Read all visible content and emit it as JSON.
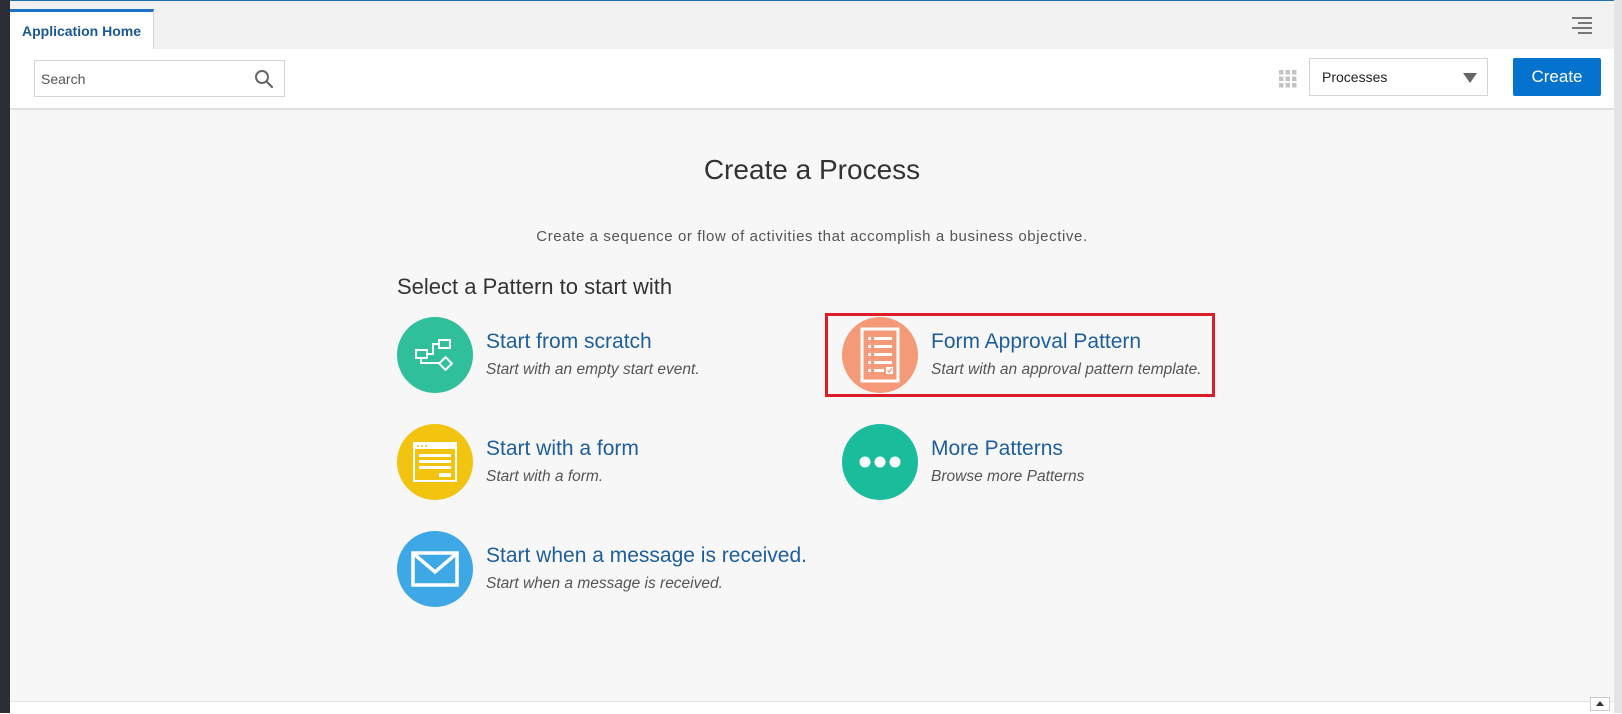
{
  "tab": {
    "label": "Application Home"
  },
  "toolbar": {
    "search_placeholder": "Search",
    "select_value": "Processes",
    "create_label": "Create"
  },
  "main": {
    "title": "Create a Process",
    "subtitle": "Create a sequence or flow of activities that accomplish a business objective.",
    "section_title": "Select a Pattern to start with",
    "patterns": [
      {
        "title": "Start from scratch",
        "description": "Start with an empty start event.",
        "icon": "flowchart-icon",
        "color": "#2fbf9b"
      },
      {
        "title": "Form Approval Pattern",
        "description": "Start with an approval pattern template.",
        "icon": "checklist-document-icon",
        "color": "#f59a78",
        "highlighted": true
      },
      {
        "title": "Start with a form",
        "description": "Start with a form.",
        "icon": "form-window-icon",
        "color": "#f2c410"
      },
      {
        "title": "More Patterns",
        "description": "Browse more Patterns",
        "icon": "ellipsis-icon",
        "color": "#19bd9b"
      },
      {
        "title": "Start when a message is received.",
        "description": "Start when a message is received.",
        "icon": "envelope-icon",
        "color": "#3ea8e6"
      }
    ]
  },
  "colors": {
    "accent": "#0572ce",
    "link": "#1e5e9c",
    "highlight_border": "#dc1e28"
  }
}
